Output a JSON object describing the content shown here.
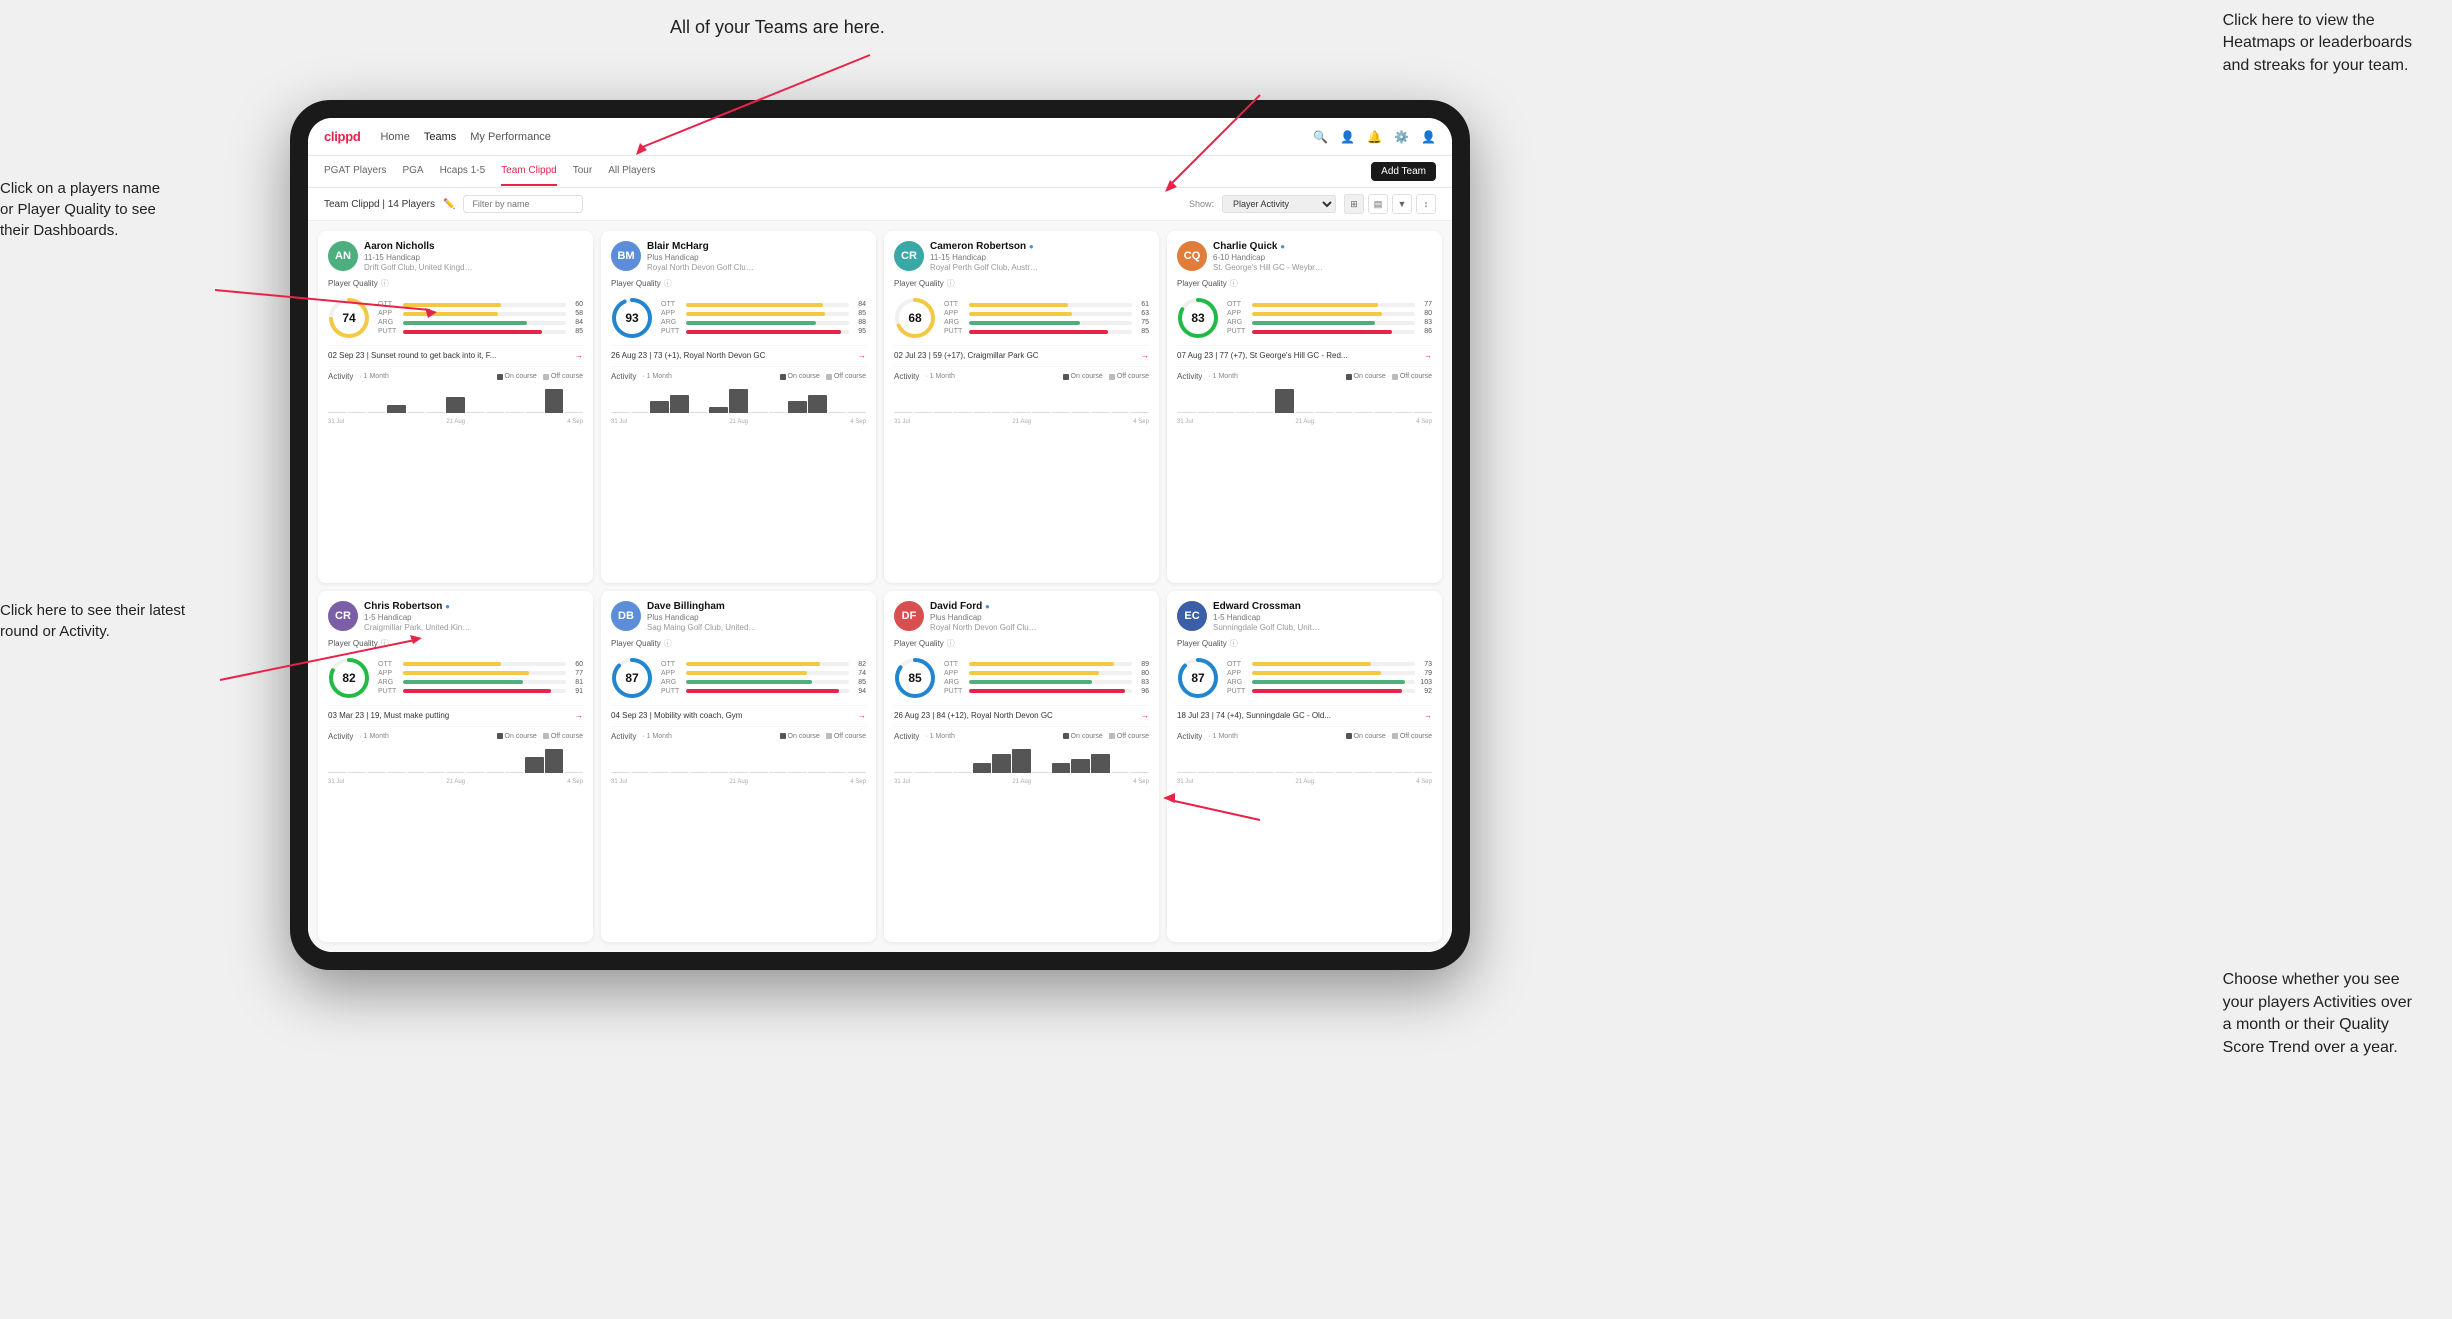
{
  "app": {
    "logo": "clippd",
    "nav": {
      "links": [
        "Home",
        "Teams",
        "My Performance"
      ]
    },
    "nav_icons": [
      "search",
      "person",
      "bell",
      "settings",
      "avatar"
    ]
  },
  "sub_nav": {
    "tabs": [
      "PGAT Players",
      "PGA",
      "Hcaps 1-5",
      "Team Clippd",
      "Tour",
      "All Players"
    ],
    "active": "Team Clippd",
    "add_team_label": "Add Team"
  },
  "team_bar": {
    "label": "Team Clippd | 14 Players",
    "filter_placeholder": "Filter by name",
    "show_label": "Show:",
    "show_value": "Player Activity",
    "view_options": [
      "grid",
      "table",
      "filter",
      "sort"
    ]
  },
  "annotations": {
    "teams": "All of your Teams are here.",
    "heatmaps": "Click here to view the\nHeatmaps or leaderboards\nand streaks for your team.",
    "player_name": "Click on a players name\nor Player Quality to see\ntheir Dashboards.",
    "latest_round": "Click here to see their latest\nround or Activity.",
    "activities": "Choose whether you see\nyour players Activities over\na month or their Quality\nScore Trend over a year."
  },
  "players": [
    {
      "id": 1,
      "name": "Aaron Nicholls",
      "handicap": "11-15 Handicap",
      "club": "Drift Golf Club, United Kingdom",
      "quality_score": 74,
      "ott": 60,
      "app": 58,
      "arg": 84,
      "putt": 85,
      "latest_round": "02 Sep 23 | Sunset round to get back into it, F...",
      "avatar_initials": "AN",
      "avatar_class": "av-green",
      "chart_bars": [
        0,
        0,
        0,
        1,
        0,
        0,
        2,
        0,
        0,
        0,
        0,
        3,
        0
      ],
      "chart_color": "#666"
    },
    {
      "id": 2,
      "name": "Blair McHarg",
      "handicap": "Plus Handicap",
      "club": "Royal North Devon Golf Club, United Kin...",
      "quality_score": 93,
      "ott": 84,
      "app": 85,
      "arg": 88,
      "putt": 95,
      "latest_round": "26 Aug 23 | 73 (+1), Royal North Devon GC",
      "avatar_initials": "BM",
      "avatar_class": "av-blue",
      "chart_bars": [
        0,
        0,
        2,
        3,
        0,
        1,
        4,
        0,
        0,
        2,
        3,
        0,
        0
      ],
      "chart_color": "#555"
    },
    {
      "id": 3,
      "name": "Cameron Robertson",
      "handicap": "11-15 Handicap",
      "club": "Royal Perth Golf Club, Australia",
      "quality_score": 68,
      "ott": 61,
      "app": 63,
      "arg": 75,
      "putt": 85,
      "latest_round": "02 Jul 23 | 59 (+17), Craigmillar Park GC",
      "avatar_initials": "CR",
      "avatar_class": "av-teal",
      "chart_bars": [
        0,
        0,
        0,
        0,
        0,
        0,
        0,
        0,
        0,
        0,
        0,
        0,
        0
      ],
      "chart_color": "#555",
      "verified": true
    },
    {
      "id": 4,
      "name": "Charlie Quick",
      "handicap": "6-10 Handicap",
      "club": "St. George's Hill GC - Weybridge - Surrey...",
      "quality_score": 83,
      "ott": 77,
      "app": 80,
      "arg": 83,
      "putt": 86,
      "latest_round": "07 Aug 23 | 77 (+7), St George's Hill GC - Red...",
      "avatar_initials": "CQ",
      "avatar_class": "av-orange",
      "chart_bars": [
        0,
        0,
        0,
        0,
        0,
        2,
        0,
        0,
        0,
        0,
        0,
        0,
        0
      ],
      "chart_color": "#555",
      "verified": true
    },
    {
      "id": 5,
      "name": "Chris Robertson",
      "handicap": "1-5 Handicap",
      "club": "Craigmillar Park, United Kingdom",
      "quality_score": 82,
      "ott": 60,
      "app": 77,
      "arg": 81,
      "putt": 91,
      "latest_round": "03 Mar 23 | 19, Must make putting",
      "avatar_initials": "CR",
      "avatar_class": "av-purple",
      "chart_bars": [
        0,
        0,
        0,
        0,
        0,
        0,
        0,
        0,
        0,
        0,
        2,
        3,
        0
      ],
      "chart_color": "#555",
      "verified": true
    },
    {
      "id": 6,
      "name": "Dave Billingham",
      "handicap": "Plus Handicap",
      "club": "Sag Maing Golf Club, United Kingdom",
      "quality_score": 87,
      "ott": 82,
      "app": 74,
      "arg": 85,
      "putt": 94,
      "latest_round": "04 Sep 23 | Mobility with coach, Gym",
      "avatar_initials": "DB",
      "avatar_class": "av-blue",
      "chart_bars": [
        0,
        0,
        0,
        0,
        0,
        0,
        0,
        0,
        0,
        0,
        0,
        0,
        0
      ],
      "chart_color": "#555"
    },
    {
      "id": 7,
      "name": "David Ford",
      "handicap": "Plus Handicap",
      "club": "Royal North Devon Golf Club, United Kil...",
      "quality_score": 85,
      "ott": 89,
      "app": 80,
      "arg": 83,
      "putt": 96,
      "latest_round": "26 Aug 23 | 84 (+12), Royal North Devon GC",
      "avatar_initials": "DF",
      "avatar_class": "av-red",
      "chart_bars": [
        0,
        0,
        0,
        0,
        2,
        4,
        5,
        0,
        2,
        3,
        4,
        0,
        0
      ],
      "chart_color": "#555",
      "verified": true
    },
    {
      "id": 8,
      "name": "Edward Crossman",
      "handicap": "1-5 Handicap",
      "club": "Sunningdale Golf Club, United Kingdom",
      "quality_score": 87,
      "ott": 73,
      "app": 79,
      "arg": 103,
      "putt": 92,
      "latest_round": "18 Jul 23 | 74 (+4), Sunningdale GC - Old...",
      "avatar_initials": "EC",
      "avatar_class": "av-darkblue",
      "chart_bars": [
        0,
        0,
        0,
        0,
        0,
        0,
        0,
        0,
        0,
        0,
        0,
        0,
        0
      ],
      "chart_color": "#555"
    }
  ],
  "chart": {
    "labels": [
      "31 Jul",
      "21 Aug",
      "4 Sep"
    ],
    "on_course_color": "#555555",
    "off_course_color": "#bbbbbb"
  },
  "activity": {
    "title": "Activity",
    "period": "· 1 Month",
    "on_course": "On course",
    "off_course": "Off course"
  }
}
